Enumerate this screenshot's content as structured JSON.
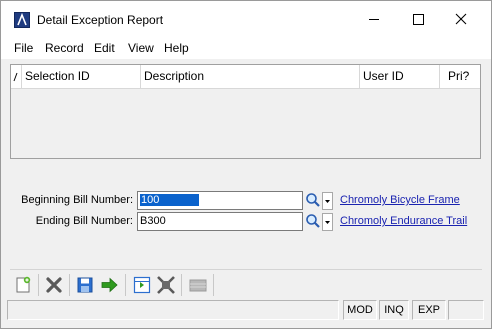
{
  "window": {
    "title": "Detail Exception Report"
  },
  "menu": {
    "items": [
      "File",
      "Record",
      "Edit",
      "View",
      "Help"
    ]
  },
  "grid": {
    "columns": [
      "Selection ID",
      "Description",
      "User ID",
      "Pri?"
    ],
    "rows": []
  },
  "form": {
    "beginning": {
      "label": "Beginning Bill Number:",
      "value": "100",
      "lookup_link": "Chromoly Bicycle Frame"
    },
    "ending": {
      "label": "Ending Bill Number:",
      "value": "B300",
      "lookup_link": "Chromoly Endurance Trail"
    }
  },
  "toolbar": {
    "buttons": [
      "new-icon",
      "delete-icon",
      "save-icon",
      "proceed-arrow-icon",
      "grid-view-icon",
      "shrink-icon",
      "disabled-bar-icon"
    ]
  },
  "status": {
    "panels": [
      "MOD",
      "INQ",
      "EXP"
    ]
  },
  "colors": {
    "selection": "#0a62cc",
    "link": "#1a23b0",
    "window_bg": "#f0f0f0"
  }
}
